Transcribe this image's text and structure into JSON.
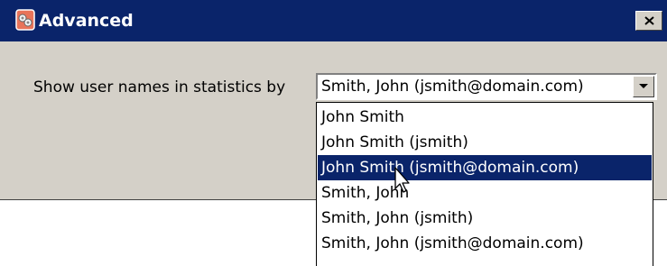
{
  "window": {
    "title": "Advanced",
    "icon": "app-icon",
    "close_label": "close-icon",
    "colors": {
      "titlebar": "#0a246a",
      "dialog": "#d4d0c8",
      "selection": "#0a246a"
    }
  },
  "setting": {
    "label": "Show user names in statistics by",
    "selected_value": "Smith, John (jsmith@domain.com)"
  },
  "dropdown": {
    "options": [
      "John Smith",
      "John Smith (jsmith)",
      "John Smith (jsmith@domain.com)",
      "Smith, John",
      "Smith, John (jsmith)",
      "Smith, John (jsmith@domain.com)"
    ],
    "highlighted": "John Smith (jsmith@domain.com)"
  }
}
